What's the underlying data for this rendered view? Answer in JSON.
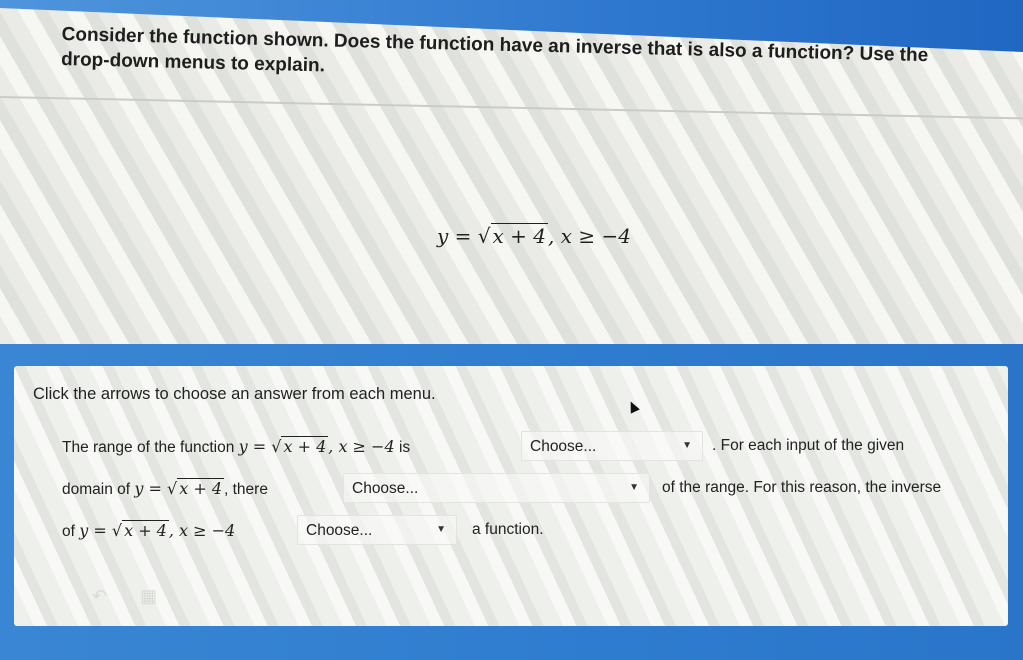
{
  "question": {
    "text": "Consider the function shown. Does the function have an inverse that is also a function? Use the\ndrop-down menus to explain.",
    "equation": {
      "lhs": "y",
      "equals": " = ",
      "sqrt": "√",
      "radicand": "x + 4",
      "condition": ", x ≥ −4"
    }
  },
  "answer": {
    "instructions": "Click the arrows to choose an answer from each menu.",
    "line1": {
      "prefix": "The range of the function",
      "eq_lhs": "y = ",
      "eq_sqrt": "√",
      "eq_radicand": "x + 4",
      "eq_cond": ", x ≥ −4",
      "suffix": "is",
      "after": ". For each input of the given"
    },
    "line2": {
      "prefix": "domain of",
      "eq_lhs": "y = ",
      "eq_sqrt": "√",
      "eq_radicand": "x + 4",
      "suffix": ", there",
      "after": "of the range. For this reason, the inverse"
    },
    "line3": {
      "prefix": "of",
      "eq_lhs": "y = ",
      "eq_sqrt": "√",
      "eq_radicand": "x + 4",
      "eq_cond": ", x ≥ −4",
      "after": "a function."
    },
    "dropdowns": [
      {
        "value": "Choose...",
        "arrow": "▼"
      },
      {
        "value": "Choose...",
        "arrow": "▼"
      },
      {
        "value": "Choose...",
        "arrow": "▼"
      }
    ]
  },
  "icons": [
    "undo-icon",
    "calculator-icon"
  ]
}
